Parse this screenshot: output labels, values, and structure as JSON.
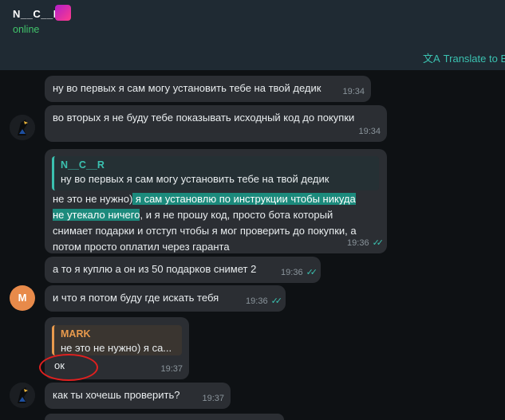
{
  "header": {
    "chat_name": "N__C__R",
    "status": "online",
    "translate_label": "Translate to E"
  },
  "messages": [
    {
      "text": "ну во первых я сам могу установить тебе на твой дедик",
      "time": "19:34"
    },
    {
      "text": "во вторых я не буду тебе показывать исходный код до покупки",
      "time": "19:34"
    },
    {
      "reply_author": "N__C__R",
      "reply_text": "ну во первых я сам могу установить тебе на твой дедик",
      "line1_plain": "не это не нужно)",
      "line1_highlight": " я сам установлю по инструкции чтобы никуда",
      "line2_highlight": "не утекало ничего",
      "line2_plain": ", и я не прошу код, просто бота который",
      "line3": "снимает подарки и отступ чтобы я мог проверить до покупки, а",
      "line4": "потом просто оплатил через гаранта",
      "time": "19:36"
    },
    {
      "text": "а то я куплю а он из 50 подарков снимет 2",
      "time": "19:36"
    },
    {
      "text": "и что я потом буду где искать тебя",
      "time": "19:36"
    },
    {
      "reply_author": "MARK",
      "reply_text": "не это не нужно) я са...",
      "text": "ок",
      "time": "19:37"
    },
    {
      "text": "как ты хочешь проверить?",
      "time": "19:37"
    }
  ],
  "avatars": {
    "m_initial": "M"
  },
  "colors": {
    "accent": "#3bc1b0",
    "online": "#41c46b",
    "reply_orange": "#e89a4d",
    "annotation_red": "#e0201f"
  },
  "icons": [
    "translate-icon",
    "double-check-icon",
    "bird-avatar-icon"
  ]
}
